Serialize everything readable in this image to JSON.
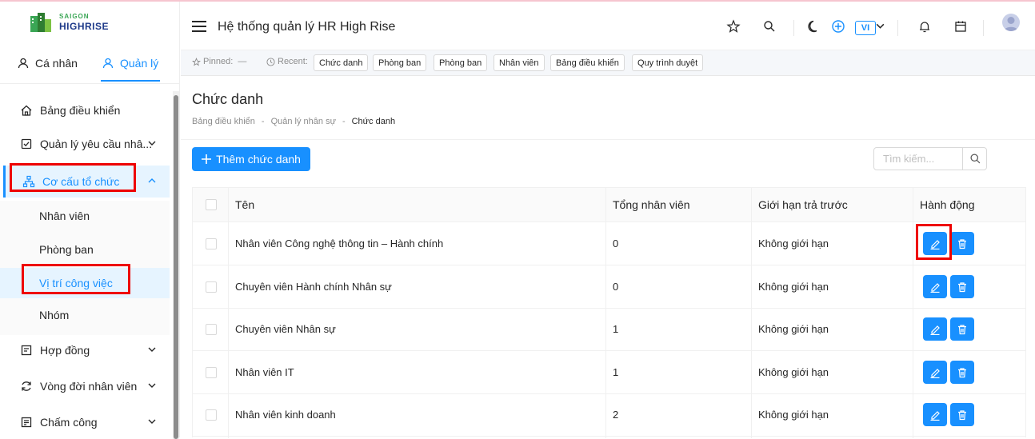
{
  "brand": {
    "line1": "SAIGON",
    "line2": "HIGHRISE"
  },
  "account_tabs": [
    {
      "label": "Cá nhân"
    },
    {
      "label": "Quản lý"
    }
  ],
  "sidebar": {
    "items": [
      {
        "label": "Bảng điều khiển",
        "icon": "home-icon"
      },
      {
        "label": "Quản lý yêu cầu nhâ...",
        "icon": "checkbox-icon"
      },
      {
        "label": "Cơ cấu tổ chức",
        "icon": "org-chart-icon"
      },
      {
        "label": "Hợp đồng",
        "icon": "contract-icon"
      },
      {
        "label": "Vòng đời nhân viên",
        "icon": "refresh-icon"
      },
      {
        "label": "Chấm công",
        "icon": "timesheet-icon"
      }
    ],
    "sub_items": [
      {
        "label": "Nhân viên"
      },
      {
        "label": "Phòng ban"
      },
      {
        "label": "Vị trí công việc"
      },
      {
        "label": "Nhóm"
      }
    ]
  },
  "header": {
    "title": "Hệ thống quản lý HR High Rise",
    "lang": "VI"
  },
  "recent": {
    "pinned_label": "Pinned:",
    "pinned_value": "—",
    "recent_label": "Recent:",
    "chips": [
      "Chức danh",
      "Phòng ban",
      "Phòng ban",
      "Nhân viên",
      "Bảng điều khiển",
      "Quy trình duyệt"
    ]
  },
  "page": {
    "title": "Chức danh",
    "breadcrumb": [
      "Bảng điều khiển",
      "-",
      "Quản lý nhân sự",
      "-",
      "Chức danh"
    ],
    "add_button": "Thêm chức danh",
    "search_placeholder": "Tìm kiếm..."
  },
  "table": {
    "columns": [
      "Tên",
      "Tổng nhân viên",
      "Giới hạn trả trước",
      "Hành động"
    ],
    "rows": [
      {
        "name": "Nhân viên Công nghệ thông tin – Hành chính",
        "total": "0",
        "limit": "Không giới hạn"
      },
      {
        "name": "Chuyên viên Hành chính Nhân sự",
        "total": "0",
        "limit": "Không giới hạn"
      },
      {
        "name": "Chuyên viên Nhân sự",
        "total": "1",
        "limit": "Không giới hạn"
      },
      {
        "name": "Nhân viên IT",
        "total": "1",
        "limit": "Không giới hạn"
      },
      {
        "name": "Nhân viên kinh doanh",
        "total": "2",
        "limit": "Không giới hạn"
      }
    ]
  },
  "colors": {
    "accent": "#1890ff",
    "highlight": "#e00000",
    "active_bg": "#e6f4ff"
  }
}
